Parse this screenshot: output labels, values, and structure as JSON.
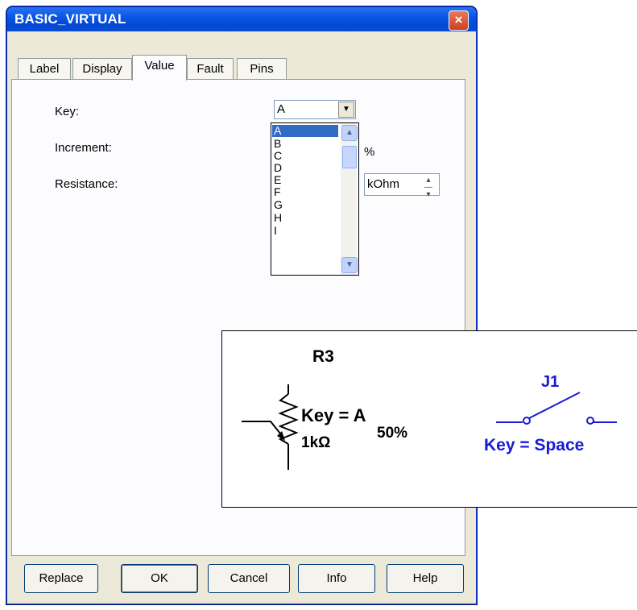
{
  "window": {
    "title": "BASIC_VIRTUAL",
    "close_icon": "×"
  },
  "tabs": [
    {
      "label": "Label"
    },
    {
      "label": "Display"
    },
    {
      "label": "Value"
    },
    {
      "label": "Fault"
    },
    {
      "label": "Pins"
    }
  ],
  "form": {
    "key_label": "Key:",
    "increment_label": "Increment:",
    "resistance_label": "Resistance:",
    "key_value": "A",
    "increment_unit": "%",
    "resistance_unit": "kOhm"
  },
  "key_list": [
    "A",
    "B",
    "C",
    "D",
    "E",
    "F",
    "G",
    "H",
    "I"
  ],
  "schematic": {
    "ref": "R3",
    "key_text": "Key = A",
    "percent_text": "50%",
    "value_text": "1kΩ",
    "switch_ref": "J1",
    "switch_key_text": "Key = Space",
    "switch_color": "#1a1ad6"
  },
  "buttons": {
    "replace": "Replace",
    "ok": "OK",
    "cancel": "Cancel",
    "info": "Info",
    "help": "Help"
  }
}
